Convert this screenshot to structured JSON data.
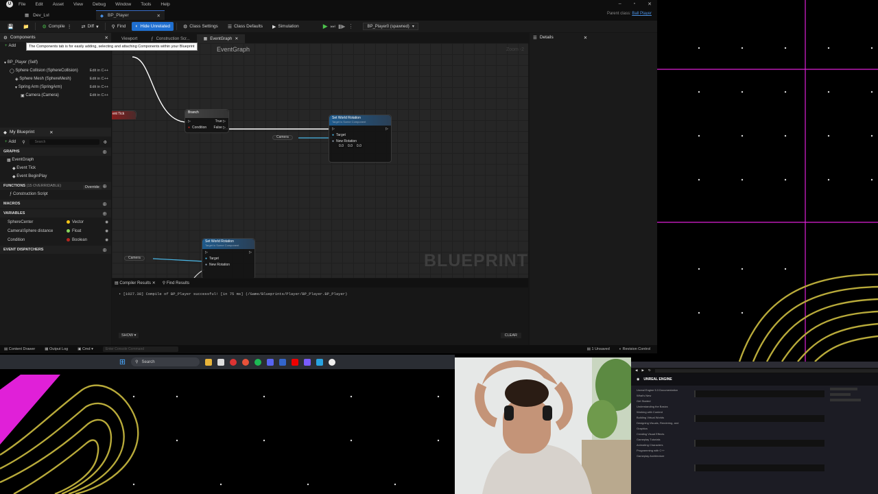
{
  "menu": {
    "items": [
      "File",
      "Edit",
      "Asset",
      "View",
      "Debug",
      "Window",
      "Tools",
      "Help"
    ]
  },
  "tabs": [
    {
      "label": "Dev_Lvl"
    },
    {
      "label": "BP_Player"
    }
  ],
  "parent_class": {
    "label": "Parent class:",
    "value": "Ball Player"
  },
  "toolbar": {
    "compile": "Compile",
    "diff": "Diff",
    "find": "Find",
    "hide_unrelated": "Hide Unrelated",
    "class_settings": "Class Settings",
    "class_defaults": "Class Defaults",
    "simulation": "Simulation",
    "debug_object": "BP_Player0 (spawned)"
  },
  "components": {
    "tab": "Components",
    "add": "Add",
    "tooltip": "The Components tab is for easily adding, selecting and attaching Components within your Blueprint",
    "root": "BP_Player (Self)",
    "items": [
      {
        "label": "Sphere Collision (SphereCollision)",
        "edit": "Edit in C++"
      },
      {
        "label": "Sphere Mesh (SphereMesh)",
        "edit": "Edit in C++"
      },
      {
        "label": "Spring Arm (SpringArm)",
        "edit": "Edit in C++"
      },
      {
        "label": "Camera (Camera)",
        "edit": "Edit in C++"
      }
    ]
  },
  "my_blueprint": {
    "tab": "My Blueprint",
    "add": "Add",
    "search_placeholder": "Search",
    "graphs_label": "GRAPHS",
    "event_graph": "EventGraph",
    "event_tick": "Event Tick",
    "event_begin": "Event BeginPlay",
    "functions_label": "FUNCTIONS",
    "functions_count": "(15 OVERRIDABLE)",
    "override": "Override",
    "construction": "Construction Script",
    "macros_label": "MACROS",
    "variables_label": "VARIABLES",
    "variables": [
      {
        "name": "SphereCenter",
        "type": "Vector",
        "color": "#f5c518"
      },
      {
        "name": "Camera\\Sphere distance",
        "type": "Float",
        "color": "#8ad65c"
      },
      {
        "name": "Condition",
        "type": "Boolean",
        "color": "#b3261e"
      }
    ],
    "dispatchers_label": "EVENT DISPATCHERS"
  },
  "graph": {
    "tabs": [
      {
        "label": "Viewport"
      },
      {
        "label": "Construction Scr..."
      },
      {
        "label": "EventGraph"
      }
    ],
    "breadcrumb": "EventGraph",
    "zoom": "Zoom -2",
    "watermark": "BLUEPRINT",
    "branch": {
      "title": "Branch",
      "cond": "Condition",
      "true": "True",
      "false": "False"
    },
    "set_rot_1": {
      "title": "Set World Rotation",
      "sub": "Target is Scene Component",
      "target": "Target",
      "newrot": "New Rotation",
      "vals": [
        "0.0",
        "0.0",
        "0.0"
      ]
    },
    "set_rot_2": {
      "title": "Set World Rotation",
      "sub": "Target is Scene Component",
      "target": "Target",
      "newrot": "New Rotation"
    },
    "camera1": "Camera",
    "camera2": "Camera",
    "event_label": "ent Tick"
  },
  "details": {
    "tab": "Details"
  },
  "bottom": {
    "tabs": [
      {
        "label": "Compiler Results"
      },
      {
        "label": "Find Results"
      }
    ],
    "log": "[1027.38] Compile of BP_Player successful! [in 75 ms] (/Game/Blueprints/Player/BP_Player.BP_Player)",
    "show": "SHOW",
    "clear": "CLEAR"
  },
  "status": {
    "content_drawer": "Content Drawer",
    "output_log": "Output Log",
    "cmd": "Cmd",
    "cmd_placeholder": "Enter Console Command",
    "unsaved": "1 Unsaved",
    "revision": "Revision Control"
  },
  "taskbar": {
    "search": "Search"
  },
  "browser": {
    "brand": "UNREAL ENGINE",
    "sidebar": [
      "Unreal Engine 5.3 Documentation",
      "What's New",
      "Get Started",
      "Understanding the Basics",
      "Working with Content",
      "Building Virtual Worlds",
      "Designing Visuals, Rendering, and Graphics",
      "Creating Visual Effects",
      "Gameplay Tutorials",
      "Animating Characters",
      "Programming with C++",
      "Gameplay Architecture"
    ]
  }
}
